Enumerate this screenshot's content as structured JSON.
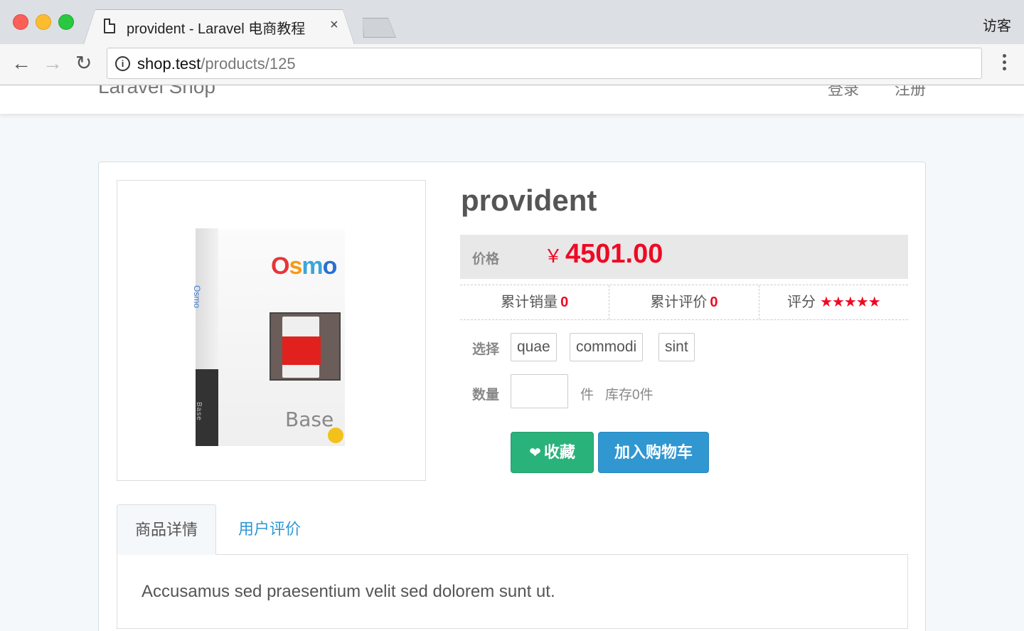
{
  "browser": {
    "tab_title": "provident - Laravel 电商教程",
    "tab_close": "×",
    "profile": "访客",
    "url_host": "shop.test",
    "url_path": "/products/125",
    "back_icon": "←",
    "forward_icon": "→",
    "reload_icon": "↻",
    "info_icon": "i"
  },
  "navbar": {
    "brand": "Laravel Shop",
    "login": "登录",
    "register": "注册"
  },
  "product": {
    "title": "provident",
    "price_label": "价格",
    "currency": "￥",
    "price": "4501.00",
    "stats": {
      "sold_label": "累计销量",
      "sold_value": "0",
      "reviews_label": "累计评价",
      "reviews_value": "0",
      "rating_label": "评分",
      "rating_stars": "★★★★★",
      "rating_value": 5
    },
    "sku_label": "选择",
    "skus": [
      "quae",
      "commodi",
      "sint"
    ],
    "qty_label": "数量",
    "qty_value": "",
    "qty_unit": "件",
    "stock": "库存0件",
    "favorite_icon": "❤",
    "favorite_label": "收藏",
    "cart_label": "加入购物车",
    "image": {
      "logo_o1": "O",
      "logo_s": "s",
      "logo_m": "m",
      "logo_o2": "o",
      "spine_logo": "Osmo",
      "spine_text": "Base",
      "front_text": "Base"
    }
  },
  "tabs": {
    "detail": "商品详情",
    "reviews": "用户评价"
  },
  "description": "Accusamus sed praesentium velit sed dolorem sunt ut.",
  "colors": {
    "price_red": "#ee0a24",
    "success_green": "#2ab27b",
    "primary_blue": "#3097d1",
    "page_bg": "#f5f8fa"
  }
}
